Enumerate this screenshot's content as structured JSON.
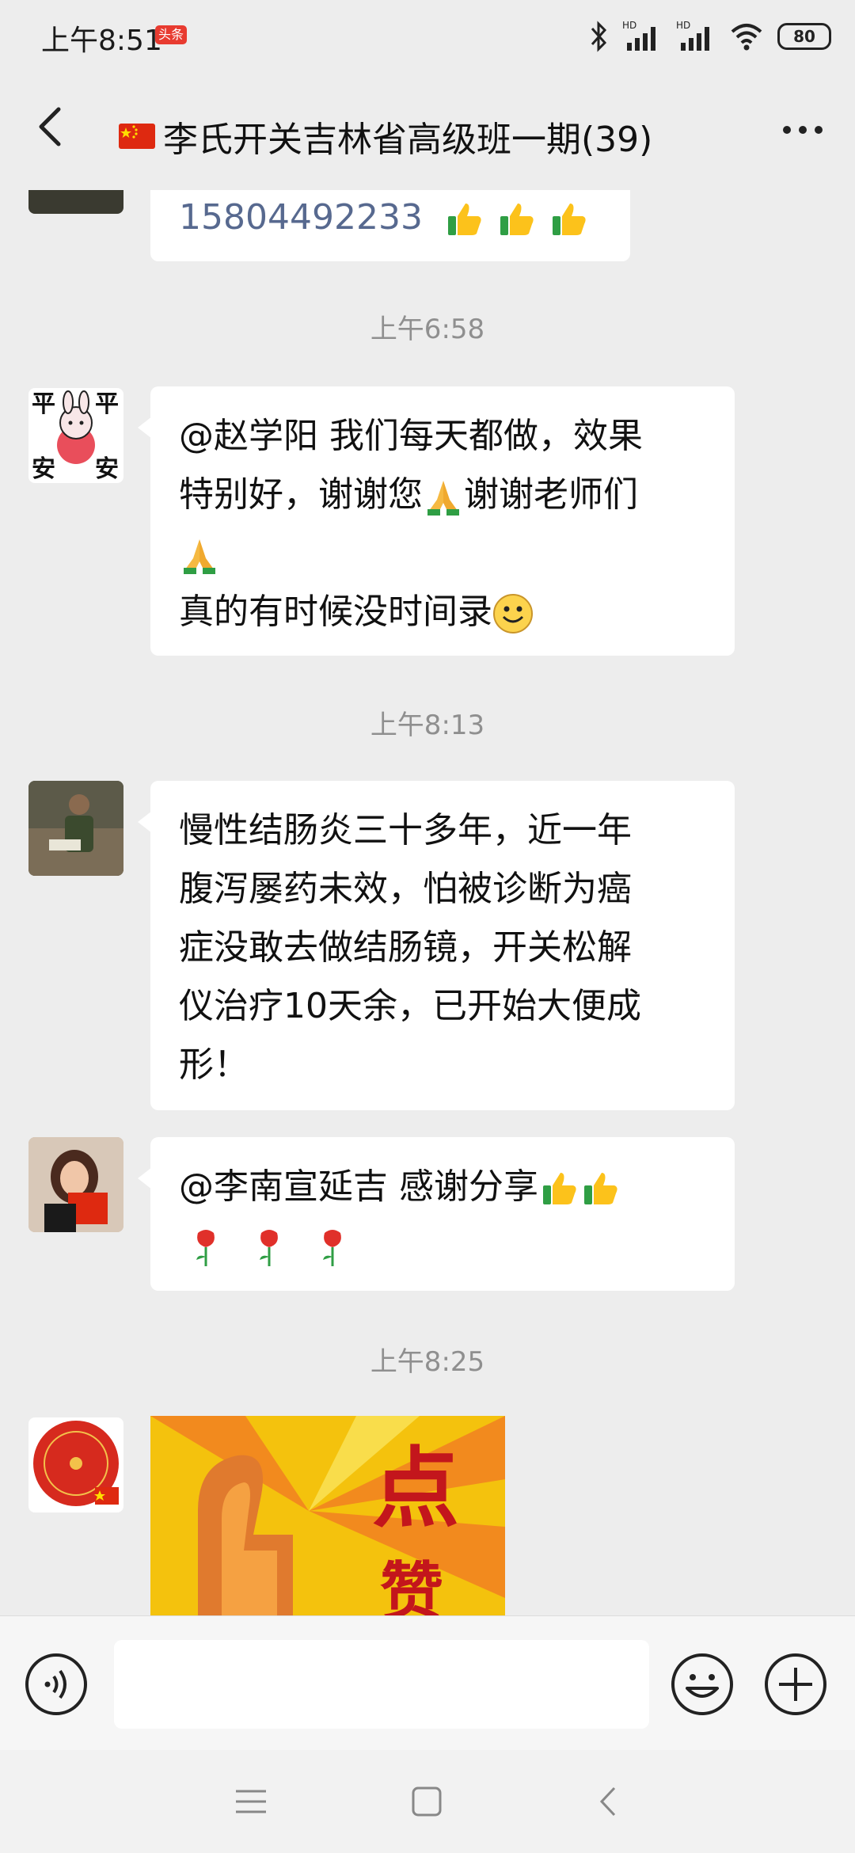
{
  "status_bar": {
    "time": "上午8:51",
    "badge": "头条",
    "battery": "80"
  },
  "header": {
    "title": "李氏开关吉林省高级班一期(39)"
  },
  "messages": [
    {
      "type": "text",
      "sender": "partial",
      "phone": "15804492233",
      "emoji": [
        "thumbs-up",
        "thumbs-up",
        "thumbs-up"
      ]
    },
    {
      "type": "timestamp",
      "text": "上午6:58"
    },
    {
      "type": "text",
      "sender": "ping-an-avatar",
      "line1": "@赵学阳  我们每天都做，效果",
      "line2a": "特别好，谢谢您",
      "line2b": "谢谢老师们",
      "line4": "真的有时候没时间录",
      "avatar_text": [
        "平",
        "平",
        "安",
        "安"
      ]
    },
    {
      "type": "timestamp",
      "text": "上午8:13"
    },
    {
      "type": "text",
      "sender": "man-reading-avatar",
      "lines": [
        "慢性结肠炎三十多年，近一年",
        "腹泻屡药未效，怕被诊断为癌",
        "症没敢去做结肠镜，开关松解",
        "仪治疗10天余，已开始大便成",
        "形！"
      ]
    },
    {
      "type": "text",
      "sender": "woman-flag-avatar",
      "line1": "@李南宣延吉  感谢分享"
    },
    {
      "type": "timestamp",
      "text": "上午8:25"
    },
    {
      "type": "image",
      "sender": "red-seal-avatar",
      "image_text": [
        "点",
        "赞"
      ]
    }
  ],
  "colors": {
    "background": "#ededed",
    "bubble": "#ffffff",
    "phone_link": "#57698f",
    "timestamp": "#8f8f8f"
  }
}
